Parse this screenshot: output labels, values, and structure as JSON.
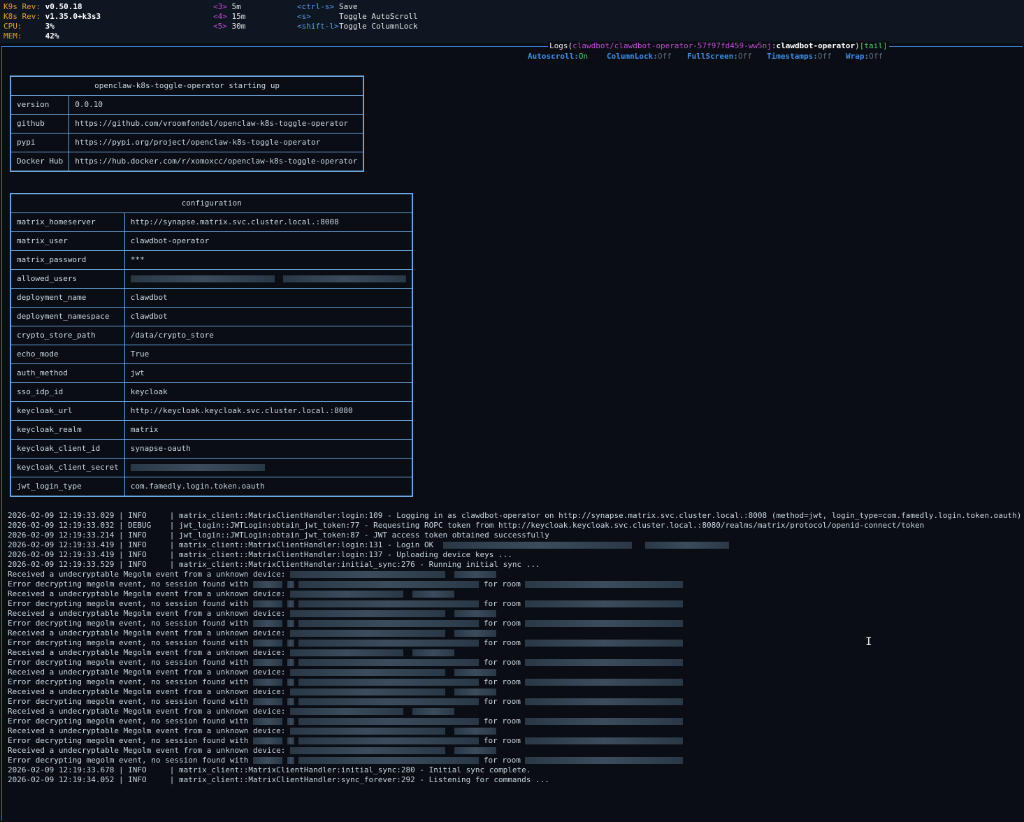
{
  "header": {
    "k9s_rev_label": "K9s Rev:",
    "k9s_rev": "v0.50.18",
    "k8s_rev_label": "K8s Rev:",
    "k8s_rev": "v1.35.0+k3s3",
    "cpu_label": "CPU:",
    "cpu": "3%",
    "mem_label": "MEM:",
    "mem": "42%",
    "shortcuts_a": [
      {
        "key": "<3>",
        "label": "5m"
      },
      {
        "key": "<4>",
        "label": "15m"
      },
      {
        "key": "<5>",
        "label": "30m"
      }
    ],
    "shortcuts_b": [
      {
        "key": "<ctrl-s>",
        "label": "Save"
      },
      {
        "key": "<s>",
        "label": "Toggle AutoScroll"
      },
      {
        "key": "<shift-l>",
        "label": "Toggle ColumnLock"
      }
    ]
  },
  "logs_title": {
    "prefix": "Logs(",
    "pod": "clawdbot/clawdbot-operator-57f97fd459-ww5nj",
    "sep": ":",
    "container": "clawdbot-operator",
    "close": ")",
    "mode": "[tail]"
  },
  "flags": [
    {
      "name": "Autoscroll:",
      "value": "On",
      "on": true
    },
    {
      "name": "ColumnLock:",
      "value": "Off",
      "on": false
    },
    {
      "name": "FullScreen:",
      "value": "Off",
      "on": false
    },
    {
      "name": "Timestamps:",
      "value": "Off",
      "on": false
    },
    {
      "name": "Wrap:",
      "value": "Off",
      "on": false
    }
  ],
  "startup_table": {
    "caption": "openclaw-k8s-toggle-operator starting up",
    "rows": [
      [
        "version",
        "0.0.10"
      ],
      [
        "github",
        "https://github.com/vroomfondel/openclaw-k8s-toggle-operator"
      ],
      [
        "pypi",
        "https://pypi.org/project/openclaw-k8s-toggle-operator"
      ],
      [
        "Docker Hub",
        "https://hub.docker.com/r/xomoxcc/openclaw-k8s-toggle-operator"
      ]
    ]
  },
  "config_table": {
    "caption": "configuration",
    "rows": [
      [
        "matrix_homeserver",
        "http://synapse.matrix.svc.cluster.local.:8008"
      ],
      [
        "matrix_user",
        "clawdbot-operator"
      ],
      [
        "matrix_password",
        "***"
      ],
      [
        "allowed_users",
        ""
      ],
      [
        "deployment_name",
        "clawdbot"
      ],
      [
        "deployment_namespace",
        "clawdbot"
      ],
      [
        "crypto_store_path",
        "/data/crypto_store"
      ],
      [
        "echo_mode",
        "True"
      ],
      [
        "auth_method",
        "jwt"
      ],
      [
        "sso_idp_id",
        "keycloak"
      ],
      [
        "keycloak_url",
        "http://keycloak.keycloak.svc.cluster.local.:8080"
      ],
      [
        "keycloak_realm",
        "matrix"
      ],
      [
        "keycloak_client_id",
        "synapse-oauth"
      ],
      [
        "keycloak_client_secret",
        ""
      ],
      [
        "jwt_login_type",
        "com.famedly.login.token.oauth"
      ]
    ]
  },
  "log_lines": [
    "2026-02-09 12:19:33.029 | INFO     | matrix_client::MatrixClientHandler:login:109 - Logging in as clawdbot-operator on http://synapse.matrix.svc.cluster.local.:8008 (method=jwt, login_type=com.famedly.login.token.oauth)",
    "2026-02-09 12:19:33.032 | DEBUG    | jwt_login::JWTLogin:obtain_jwt_token:77 - Requesting ROPC token from http://keycloak.keycloak.svc.cluster.local.:8080/realms/matrix/protocol/openid-connect/token",
    "2026-02-09 12:19:33.214 | INFO     | jwt_login::JWTLogin:obtain_jwt_token:87 - JWT access token obtained successfully",
    "2026-02-09 12:19:33.419 | INFO     | matrix_client::MatrixClientHandler:login:131 - Login OK",
    "2026-02-09 12:19:33.419 | INFO     | matrix_client::MatrixClientHandler:login:137 - Uploading device keys ...",
    "2026-02-09 12:19:33.529 | INFO     | matrix_client::MatrixClientHandler:initial_sync:276 - Running initial sync ..."
  ],
  "megolm": {
    "received": "Received a undecryptable Megolm event from a unknown device:",
    "error": "Error decrypting megolm event, no session found with",
    "for_room": "for room"
  },
  "tail_lines": [
    "2026-02-09 12:19:33.678 | INFO     | matrix_client::MatrixClientHandler:initial_sync:280 - Initial sync complete.",
    "2026-02-09 12:19:34.052 | INFO     | matrix_client::MatrixClientHandler:sync_forever:292 - Listening for commands ..."
  ]
}
